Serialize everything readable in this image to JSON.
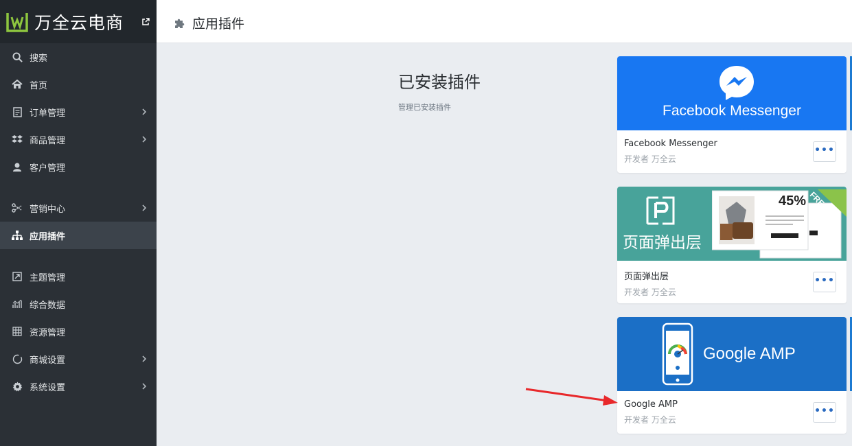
{
  "brand": {
    "name": "万全云电商"
  },
  "topbar": {
    "title": "应用插件"
  },
  "menu": [
    {
      "label": "搜索",
      "icon": "search-icon",
      "chevron": false,
      "active": false
    },
    {
      "label": "首页",
      "icon": "home-icon",
      "chevron": false,
      "active": false
    },
    {
      "label": "订单管理",
      "icon": "order-icon",
      "chevron": true,
      "active": false
    },
    {
      "label": "商品管理",
      "icon": "product-icon",
      "chevron": true,
      "active": false
    },
    {
      "label": "客户管理",
      "icon": "customer-icon",
      "chevron": false,
      "active": false
    },
    {
      "label": "营销中心",
      "icon": "marketing-icon",
      "chevron": true,
      "active": false
    },
    {
      "label": "应用插件",
      "icon": "sitemap-icon",
      "chevron": false,
      "active": true
    },
    {
      "label": "主题管理",
      "icon": "theme-icon",
      "chevron": false,
      "active": false
    },
    {
      "label": "综合数据",
      "icon": "chart-icon",
      "chevron": false,
      "active": false
    },
    {
      "label": "资源管理",
      "icon": "grid-icon",
      "chevron": false,
      "active": false
    },
    {
      "label": "商城设置",
      "icon": "circle-icon",
      "chevron": true,
      "active": false
    },
    {
      "label": "系统设置",
      "icon": "gear-icon",
      "chevron": true,
      "active": false
    }
  ],
  "section": {
    "title": "已安装插件",
    "subtitle": "管理已安装插件"
  },
  "plugins": [
    {
      "name": "Facebook Messenger",
      "developer": "开发者 万全云",
      "banner_text": "Facebook Messenger",
      "banner_color": "#1877f2"
    },
    {
      "name": "页面弹出层",
      "developer": "开发者 万全云",
      "banner_text": "页面弹出层",
      "badge": "FREE",
      "discount": "45%",
      "banner_color": "#48a39a"
    },
    {
      "name": "Google AMP",
      "developer": "开发者 万全云",
      "banner_text": "Google AMP",
      "banner_color": "#1b6fc6"
    }
  ],
  "more_label": "•••"
}
